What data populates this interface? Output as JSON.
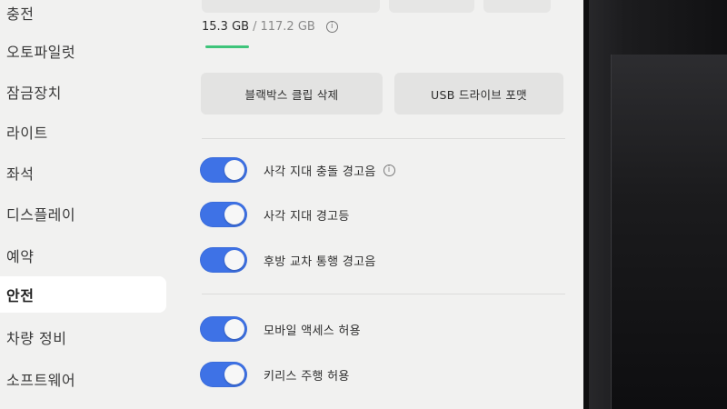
{
  "sidebar": {
    "items": [
      {
        "label": "충전",
        "active": false
      },
      {
        "label": "오토파일럿",
        "active": false
      },
      {
        "label": "잠금장치",
        "active": false
      },
      {
        "label": "라이트",
        "active": false
      },
      {
        "label": "좌석",
        "active": false
      },
      {
        "label": "디스플레이",
        "active": false
      },
      {
        "label": "예약",
        "active": false
      },
      {
        "label": "안전",
        "active": true
      },
      {
        "label": "차량 정비",
        "active": false
      },
      {
        "label": "소프트웨어",
        "active": false
      }
    ]
  },
  "storage": {
    "used": "15.3 GB",
    "separator": " / ",
    "total": "117.2 GB",
    "info_icon": "info-icon",
    "used_fraction": 0.13,
    "bar_color": "#3ec47a"
  },
  "actions": {
    "delete_clips_label": "블랙박스 클립 삭제",
    "format_usb_label": "USB 드라이브 포맷"
  },
  "toggles": [
    {
      "label": "사각 지대 충돌 경고음",
      "on": true,
      "has_info": true
    },
    {
      "label": "사각 지대 경고등",
      "on": true,
      "has_info": false
    },
    {
      "label": "후방 교차 통행 경고음",
      "on": true,
      "has_info": false
    },
    {
      "label": "모바일 액세스 허용",
      "on": true,
      "has_info": false
    },
    {
      "label": "키리스 주행 허용",
      "on": true,
      "has_info": false
    }
  ],
  "colors": {
    "toggle_on": "#3e72e6",
    "screen_bg": "#f1f1f0"
  }
}
